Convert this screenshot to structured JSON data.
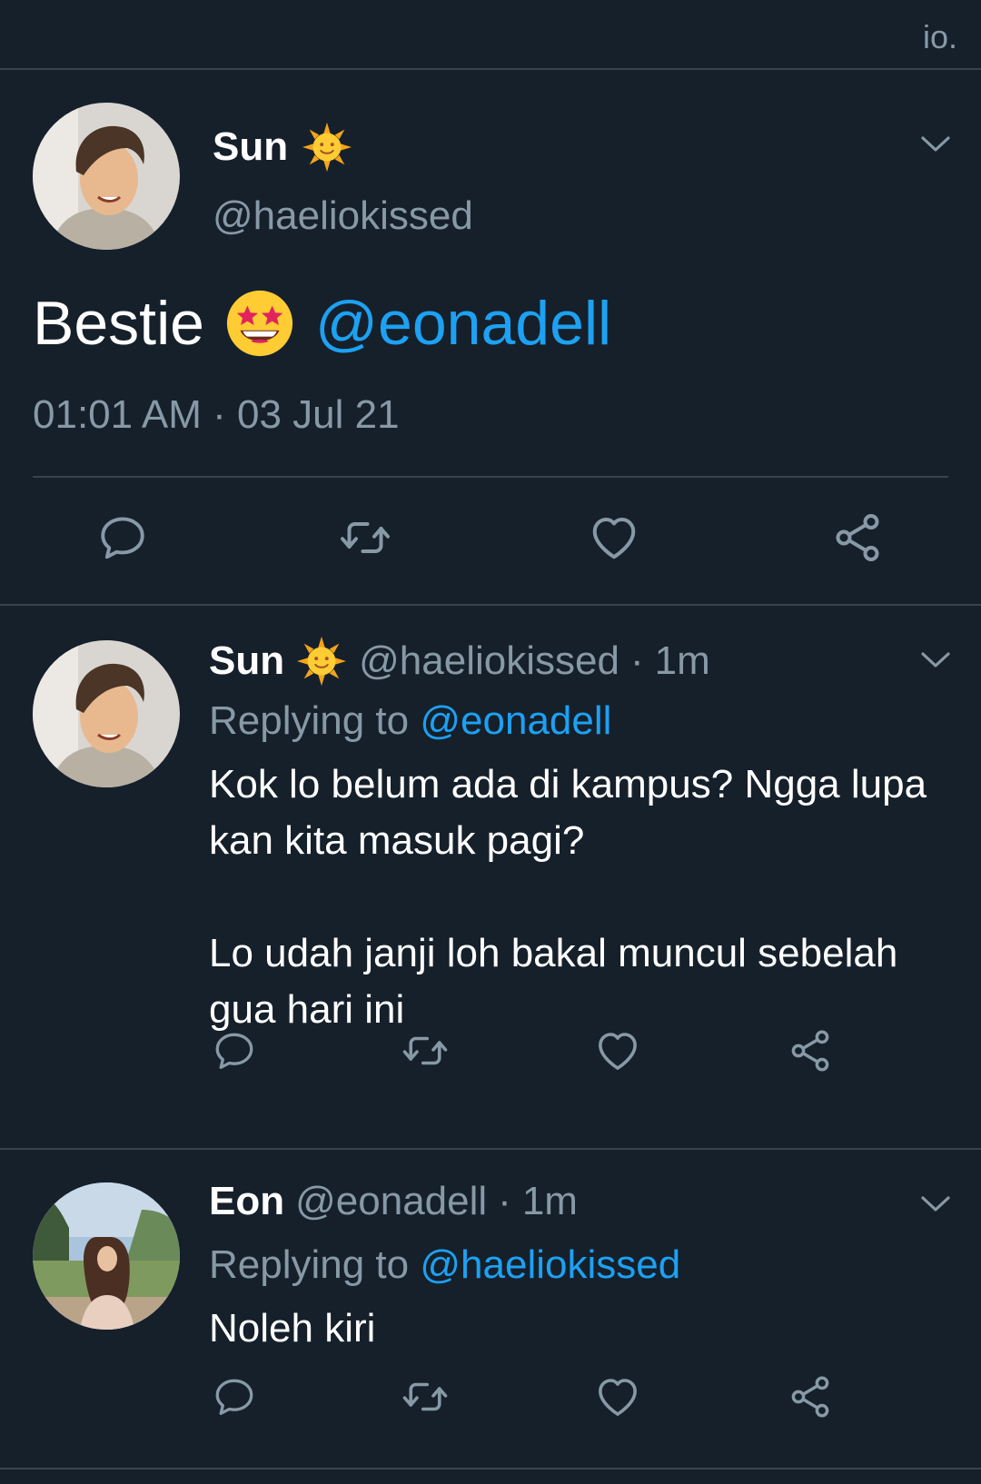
{
  "topbar": {
    "corner_text": "io."
  },
  "main_tweet": {
    "name": "Sun",
    "name_emoji": "sun-with-face",
    "handle": "@haeliokissed",
    "text": "Bestie",
    "text_emoji": "star-struck",
    "mention": "@eonadell",
    "timestamp": "01:01 AM · 03 Jul 21"
  },
  "replies": [
    {
      "name": "Sun",
      "name_emoji": "sun-with-face",
      "handle": "@haeliokissed",
      "separator": "·",
      "time": "1m",
      "replying_prefix": "Replying to",
      "replying_to": "@eonadell",
      "paragraphs": [
        "Kok lo belum ada di kampus? Ngga lupa kan kita masuk pagi?",
        "Lo udah janji loh bakal muncul sebelah gua hari ini"
      ]
    },
    {
      "name": "Eon",
      "handle": "@eonadell",
      "separator": "·",
      "time": "1m",
      "replying_prefix": "Replying to",
      "replying_to": "@haeliokissed",
      "paragraphs": [
        "Noleh kiri"
      ]
    }
  ],
  "icons": {
    "reply": "reply-icon",
    "retweet": "retweet-icon",
    "like": "heart-icon",
    "share": "share-icon",
    "menu": "chevron-down-icon"
  },
  "colors": {
    "background": "#15202b",
    "divider": "#38444d",
    "secondary_text": "#8899a6",
    "accent": "#1da1f2",
    "primary_text": "#ffffff"
  }
}
